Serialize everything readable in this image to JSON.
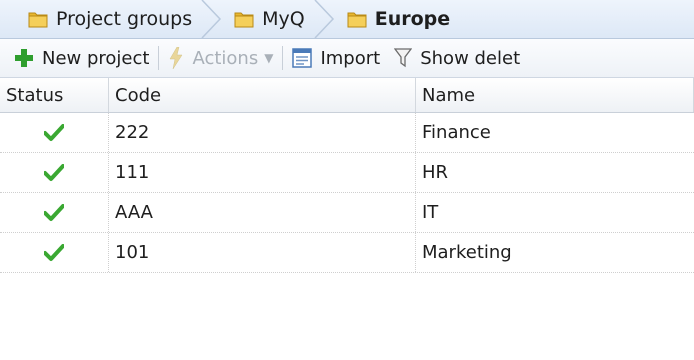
{
  "breadcrumb": {
    "items": [
      {
        "label": "Project groups"
      },
      {
        "label": "MyQ"
      },
      {
        "label": "Europe"
      }
    ]
  },
  "toolbar": {
    "new_project_label": "New project",
    "actions_label": "Actions",
    "import_label": "Import",
    "show_deleted_label": "Show delet"
  },
  "table": {
    "columns": [
      "Status",
      "Code",
      "Name"
    ],
    "rows": [
      {
        "status": "active",
        "code": "222",
        "name": "Finance"
      },
      {
        "status": "active",
        "code": "111",
        "name": "HR"
      },
      {
        "status": "active",
        "code": "AAA",
        "name": "IT"
      },
      {
        "status": "active",
        "code": "101",
        "name": "Marketing"
      }
    ]
  },
  "colors": {
    "check_green": "#3aa832",
    "plus_green": "#2e9e2e",
    "folder_yellow": "#e8b730",
    "breadcrumb_bg": "#dde8f6"
  }
}
